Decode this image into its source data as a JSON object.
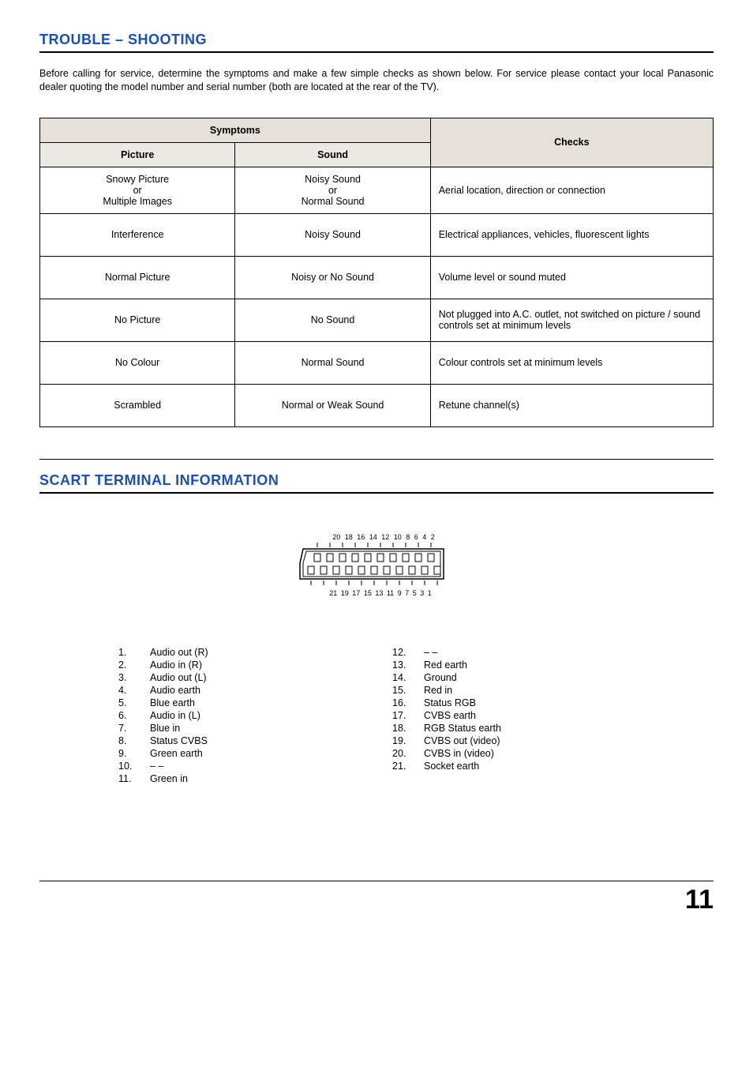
{
  "page_number": "11",
  "sections": {
    "trouble": {
      "title": "TROUBLE – SHOOTING",
      "intro": "Before calling for service, determine the symptoms and make a few simple checks as shown below. For service please contact your local Panasonic dealer quoting the model number and serial number (both are located at the rear of the TV).",
      "headers": {
        "symptoms": "Symptoms",
        "checks": "Checks",
        "picture": "Picture",
        "sound": "Sound"
      },
      "rows": [
        {
          "picture": "Snowy Picture\nor\nMultiple Images",
          "sound": "Noisy Sound\nor\nNormal Sound",
          "check": "Aerial location, direction or connection"
        },
        {
          "picture": "Interference",
          "sound": "Noisy Sound",
          "check": "Electrical appliances, vehicles, fluorescent lights"
        },
        {
          "picture": "Normal Picture",
          "sound": "Noisy or No Sound",
          "check": "Volume level or sound muted"
        },
        {
          "picture": "No Picture",
          "sound": "No Sound",
          "check": "Not plugged into A.C. outlet, not switched on picture / sound controls set at minimum levels"
        },
        {
          "picture": "No Colour",
          "sound": "Normal Sound",
          "check": "Colour controls set at minimum levels"
        },
        {
          "picture": "Scrambled",
          "sound": "Normal or Weak Sound",
          "check": "Retune channel(s)"
        }
      ]
    },
    "scart": {
      "title": "SCART TERMINAL INFORMATION",
      "top_labels": "20 18 16 14 12 10  8  6  4  2",
      "bottom_labels": "21 19 17 15 13  11 9 7   5  3  1",
      "pins_left": [
        {
          "n": "1.",
          "t": "Audio out (R)"
        },
        {
          "n": "2.",
          "t": "Audio in (R)"
        },
        {
          "n": "3.",
          "t": "Audio out (L)"
        },
        {
          "n": "4.",
          "t": "Audio earth"
        },
        {
          "n": "5.",
          "t": "Blue earth"
        },
        {
          "n": "6.",
          "t": "Audio in (L)"
        },
        {
          "n": "7.",
          "t": "Blue in"
        },
        {
          "n": "8.",
          "t": "Status CVBS"
        },
        {
          "n": "9.",
          "t": "Green earth"
        },
        {
          "n": "10.",
          "t": "– –"
        },
        {
          "n": "11.",
          "t": "Green in"
        }
      ],
      "pins_right": [
        {
          "n": "12.",
          "t": "– –"
        },
        {
          "n": "13.",
          "t": "Red earth"
        },
        {
          "n": "14.",
          "t": "Ground"
        },
        {
          "n": "15.",
          "t": "Red in"
        },
        {
          "n": "16.",
          "t": "Status RGB"
        },
        {
          "n": "17.",
          "t": "CVBS earth"
        },
        {
          "n": "18.",
          "t": "RGB Status earth"
        },
        {
          "n": "19.",
          "t": "CVBS out (video)"
        },
        {
          "n": "20.",
          "t": "CVBS in (video)"
        },
        {
          "n": "21.",
          "t": "Socket earth"
        }
      ]
    }
  }
}
